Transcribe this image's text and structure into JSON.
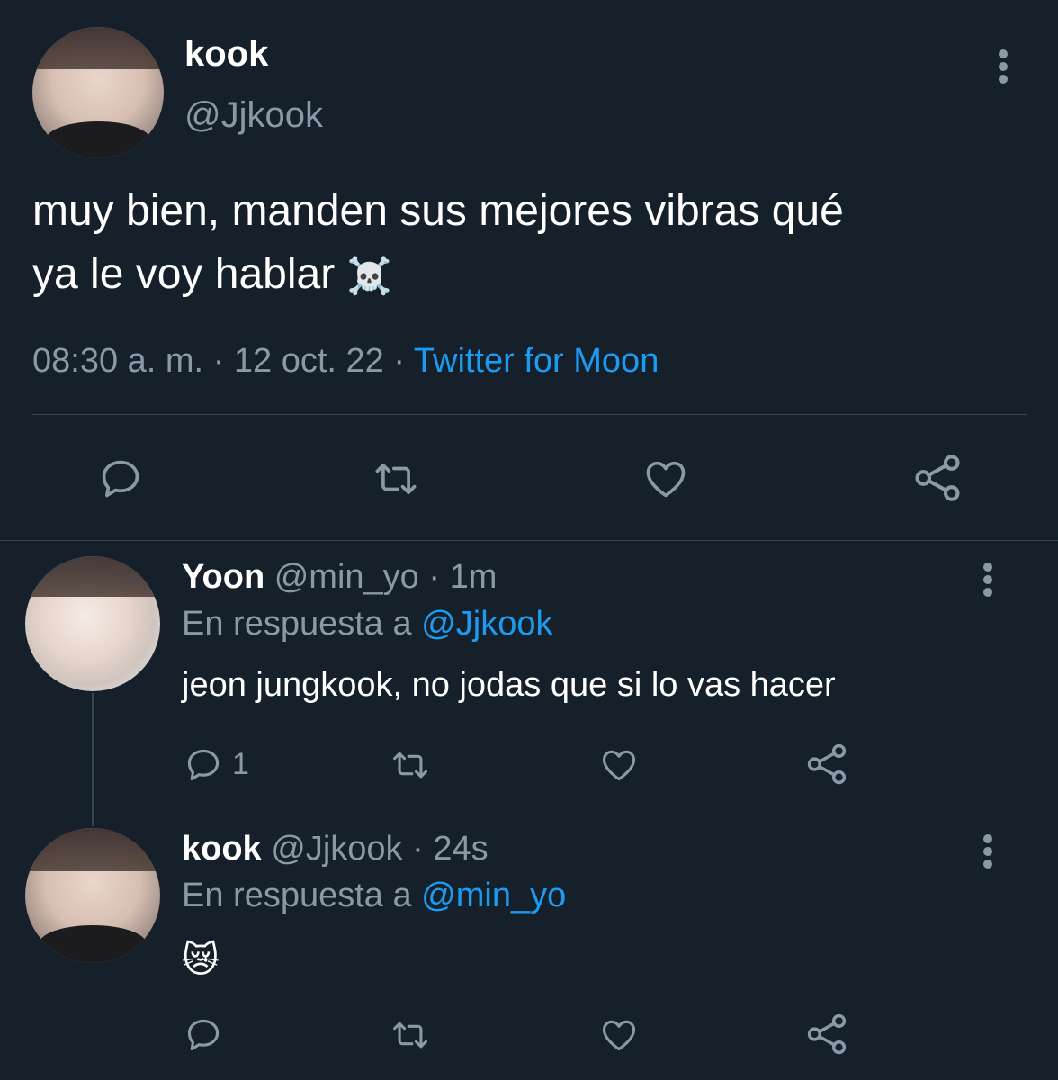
{
  "main_tweet": {
    "name": "kook",
    "handle": "@Jjkook",
    "text_line1": "muy bien, manden sus mejores vibras qué",
    "text_line2": "ya le voy hablar",
    "emoji": "☠️",
    "time": "08:30 a. m.",
    "dot": "·",
    "date": "12 oct. 22",
    "source": "Twitter for Moon"
  },
  "reply1": {
    "name": "Yoon",
    "handle": "@min_yo",
    "dot": "·",
    "time": "1m",
    "reply_prefix": "En respuesta a",
    "reply_to": "@Jjkook",
    "text": "jeon jungkook, no jodas que si lo vas hacer",
    "reply_count": "1"
  },
  "reply2": {
    "name": "kook",
    "handle": "@Jjkook",
    "dot": "·",
    "time": "24s",
    "reply_prefix": "En respuesta a",
    "reply_to": "@min_yo",
    "emoji": "😿"
  },
  "colors": {
    "background": "#15202b",
    "muted": "#8b98a5",
    "link": "#1d9bf0",
    "divider": "#38444d"
  },
  "icons": [
    "more-icon",
    "reply-icon",
    "retweet-icon",
    "like-icon",
    "share-icon"
  ]
}
